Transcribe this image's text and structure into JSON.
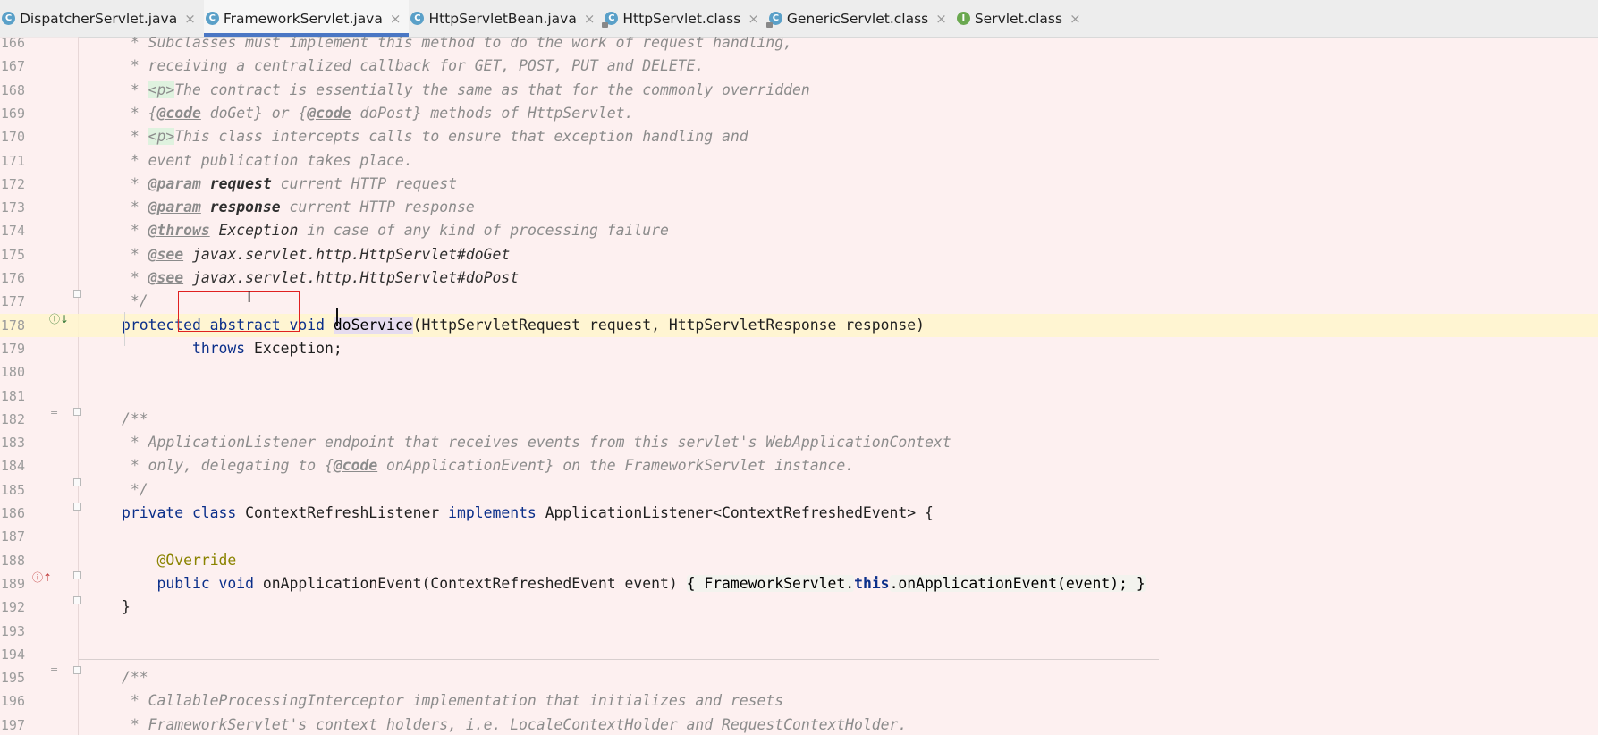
{
  "tabs": [
    {
      "label": "DispatcherServlet.java",
      "icon": "class-icon",
      "active": false
    },
    {
      "label": "FrameworkServlet.java",
      "icon": "class-icon",
      "active": true
    },
    {
      "label": "HttpServletBean.java",
      "icon": "class-icon",
      "active": false
    },
    {
      "label": "HttpServlet.class",
      "icon": "class-icon-locked",
      "active": false
    },
    {
      "label": "GenericServlet.class",
      "icon": "class-icon-locked",
      "active": false
    },
    {
      "label": "Servlet.class",
      "icon": "interface-icon",
      "active": false
    }
  ],
  "tab_close_glyph": "×",
  "icon_letters": {
    "class": "C",
    "interface": "I"
  },
  "lines": [
    {
      "n": "166",
      "segs": [
        [
          "doc",
          " * Subclasses must implement this method to do the work of request handling,"
        ]
      ]
    },
    {
      "n": "167",
      "segs": [
        [
          "doc",
          " * receiving a centralized callback for GET, POST, PUT and DELETE."
        ]
      ]
    },
    {
      "n": "168",
      "segs": [
        [
          "doc",
          " * "
        ],
        [
          "html",
          "<p>"
        ],
        [
          "doc",
          "The contract is essentially the same as that for the commonly overridden"
        ]
      ]
    },
    {
      "n": "169",
      "segs": [
        [
          "doc",
          " * {"
        ],
        [
          "tag",
          "@code"
        ],
        [
          "doc",
          " doGet} or {"
        ],
        [
          "tag",
          "@code"
        ],
        [
          "doc",
          " doPost} methods of HttpServlet."
        ]
      ]
    },
    {
      "n": "170",
      "segs": [
        [
          "doc",
          " * "
        ],
        [
          "html",
          "<p>"
        ],
        [
          "doc",
          "This class intercepts calls to ensure that exception handling and"
        ]
      ]
    },
    {
      "n": "171",
      "segs": [
        [
          "doc",
          " * event publication takes place."
        ]
      ]
    },
    {
      "n": "172",
      "segs": [
        [
          "doc",
          " * "
        ],
        [
          "tag",
          "@param"
        ],
        [
          "doc",
          " "
        ],
        [
          "refb",
          "request"
        ],
        [
          "doc",
          " current HTTP request"
        ]
      ]
    },
    {
      "n": "173",
      "segs": [
        [
          "doc",
          " * "
        ],
        [
          "tag",
          "@param"
        ],
        [
          "doc",
          " "
        ],
        [
          "refb",
          "response"
        ],
        [
          "doc",
          " current HTTP response"
        ]
      ]
    },
    {
      "n": "174",
      "segs": [
        [
          "doc",
          " * "
        ],
        [
          "tag",
          "@throws"
        ],
        [
          "doc",
          " "
        ],
        [
          "ref",
          "Exception"
        ],
        [
          "doc",
          " in case of any kind of processing failure"
        ]
      ]
    },
    {
      "n": "175",
      "segs": [
        [
          "doc",
          " * "
        ],
        [
          "tag",
          "@see"
        ],
        [
          "doc",
          " "
        ],
        [
          "ref",
          "javax.servlet.http.HttpServlet#doGet"
        ]
      ]
    },
    {
      "n": "176",
      "segs": [
        [
          "doc",
          " * "
        ],
        [
          "tag",
          "@see"
        ],
        [
          "doc",
          " "
        ],
        [
          "ref",
          "javax.servlet.http.HttpServlet#doPost"
        ]
      ]
    },
    {
      "n": "177",
      "segs": [
        [
          "doc",
          " */"
        ]
      ]
    },
    {
      "n": "178",
      "current": true,
      "segs": [
        [
          "kw",
          "protected abstract void "
        ],
        [
          "method-hl",
          "doService"
        ],
        [
          "plain",
          "(HttpServletRequest request, HttpServletResponse response)"
        ]
      ]
    },
    {
      "n": "179",
      "segs": [
        [
          "plain",
          "        "
        ],
        [
          "kw",
          "throws "
        ],
        [
          "plain",
          "Exception;"
        ]
      ]
    },
    {
      "n": "180",
      "segs": []
    },
    {
      "n": "181",
      "segs": []
    },
    {
      "n": "182",
      "segs": [
        [
          "doc",
          "/**"
        ]
      ]
    },
    {
      "n": "183",
      "segs": [
        [
          "doc",
          " * ApplicationListener endpoint that receives events from this servlet's WebApplicationContext"
        ]
      ]
    },
    {
      "n": "184",
      "segs": [
        [
          "doc",
          " * only, delegating to {"
        ],
        [
          "tag",
          "@code"
        ],
        [
          "doc",
          " onApplicationEvent} on the FrameworkServlet instance."
        ]
      ]
    },
    {
      "n": "185",
      "segs": [
        [
          "doc",
          " */"
        ]
      ]
    },
    {
      "n": "186",
      "segs": [
        [
          "kw",
          "private class "
        ],
        [
          "plain",
          "ContextRefreshListener "
        ],
        [
          "kw",
          "implements "
        ],
        [
          "plain",
          "ApplicationListener<ContextRefreshedEvent> {"
        ]
      ]
    },
    {
      "n": "187",
      "segs": []
    },
    {
      "n": "188",
      "segs": [
        [
          "plain",
          "    "
        ],
        [
          "anno",
          "@Override"
        ]
      ]
    },
    {
      "n": "189",
      "segs": [
        [
          "plain",
          "    "
        ],
        [
          "kw",
          "public void "
        ],
        [
          "plain",
          "onApplicationEvent(ContextRefreshedEvent event) "
        ],
        [
          "fold-body",
          "{ FrameworkServlet."
        ],
        [
          "this",
          "this"
        ],
        [
          "fold-body",
          ".onApplicationEvent(event); }"
        ]
      ]
    },
    {
      "n": "192",
      "segs": [
        [
          "plain",
          "}"
        ]
      ]
    },
    {
      "n": "193",
      "segs": []
    },
    {
      "n": "194",
      "segs": []
    },
    {
      "n": "195",
      "segs": [
        [
          "doc",
          "/**"
        ]
      ]
    },
    {
      "n": "196",
      "segs": [
        [
          "doc",
          " * CallableProcessingInterceptor implementation that initializes and resets"
        ]
      ]
    },
    {
      "n": "197",
      "segs": [
        [
          "doc",
          " * FrameworkServlet's context holders, i.e. LocaleContextHolder and RequestContextHolder."
        ]
      ]
    }
  ],
  "cursor_glyph": "I"
}
